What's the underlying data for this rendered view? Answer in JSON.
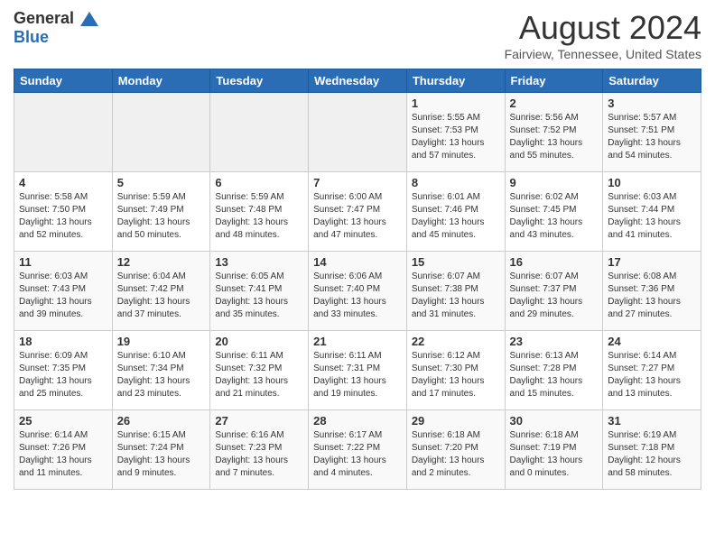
{
  "header": {
    "logo_line1": "General",
    "logo_line2": "Blue",
    "month": "August 2024",
    "location": "Fairview, Tennessee, United States"
  },
  "weekdays": [
    "Sunday",
    "Monday",
    "Tuesday",
    "Wednesday",
    "Thursday",
    "Friday",
    "Saturday"
  ],
  "weeks": [
    [
      {
        "day": "",
        "info": ""
      },
      {
        "day": "",
        "info": ""
      },
      {
        "day": "",
        "info": ""
      },
      {
        "day": "",
        "info": ""
      },
      {
        "day": "1",
        "info": "Sunrise: 5:55 AM\nSunset: 7:53 PM\nDaylight: 13 hours\nand 57 minutes."
      },
      {
        "day": "2",
        "info": "Sunrise: 5:56 AM\nSunset: 7:52 PM\nDaylight: 13 hours\nand 55 minutes."
      },
      {
        "day": "3",
        "info": "Sunrise: 5:57 AM\nSunset: 7:51 PM\nDaylight: 13 hours\nand 54 minutes."
      }
    ],
    [
      {
        "day": "4",
        "info": "Sunrise: 5:58 AM\nSunset: 7:50 PM\nDaylight: 13 hours\nand 52 minutes."
      },
      {
        "day": "5",
        "info": "Sunrise: 5:59 AM\nSunset: 7:49 PM\nDaylight: 13 hours\nand 50 minutes."
      },
      {
        "day": "6",
        "info": "Sunrise: 5:59 AM\nSunset: 7:48 PM\nDaylight: 13 hours\nand 48 minutes."
      },
      {
        "day": "7",
        "info": "Sunrise: 6:00 AM\nSunset: 7:47 PM\nDaylight: 13 hours\nand 47 minutes."
      },
      {
        "day": "8",
        "info": "Sunrise: 6:01 AM\nSunset: 7:46 PM\nDaylight: 13 hours\nand 45 minutes."
      },
      {
        "day": "9",
        "info": "Sunrise: 6:02 AM\nSunset: 7:45 PM\nDaylight: 13 hours\nand 43 minutes."
      },
      {
        "day": "10",
        "info": "Sunrise: 6:03 AM\nSunset: 7:44 PM\nDaylight: 13 hours\nand 41 minutes."
      }
    ],
    [
      {
        "day": "11",
        "info": "Sunrise: 6:03 AM\nSunset: 7:43 PM\nDaylight: 13 hours\nand 39 minutes."
      },
      {
        "day": "12",
        "info": "Sunrise: 6:04 AM\nSunset: 7:42 PM\nDaylight: 13 hours\nand 37 minutes."
      },
      {
        "day": "13",
        "info": "Sunrise: 6:05 AM\nSunset: 7:41 PM\nDaylight: 13 hours\nand 35 minutes."
      },
      {
        "day": "14",
        "info": "Sunrise: 6:06 AM\nSunset: 7:40 PM\nDaylight: 13 hours\nand 33 minutes."
      },
      {
        "day": "15",
        "info": "Sunrise: 6:07 AM\nSunset: 7:38 PM\nDaylight: 13 hours\nand 31 minutes."
      },
      {
        "day": "16",
        "info": "Sunrise: 6:07 AM\nSunset: 7:37 PM\nDaylight: 13 hours\nand 29 minutes."
      },
      {
        "day": "17",
        "info": "Sunrise: 6:08 AM\nSunset: 7:36 PM\nDaylight: 13 hours\nand 27 minutes."
      }
    ],
    [
      {
        "day": "18",
        "info": "Sunrise: 6:09 AM\nSunset: 7:35 PM\nDaylight: 13 hours\nand 25 minutes."
      },
      {
        "day": "19",
        "info": "Sunrise: 6:10 AM\nSunset: 7:34 PM\nDaylight: 13 hours\nand 23 minutes."
      },
      {
        "day": "20",
        "info": "Sunrise: 6:11 AM\nSunset: 7:32 PM\nDaylight: 13 hours\nand 21 minutes."
      },
      {
        "day": "21",
        "info": "Sunrise: 6:11 AM\nSunset: 7:31 PM\nDaylight: 13 hours\nand 19 minutes."
      },
      {
        "day": "22",
        "info": "Sunrise: 6:12 AM\nSunset: 7:30 PM\nDaylight: 13 hours\nand 17 minutes."
      },
      {
        "day": "23",
        "info": "Sunrise: 6:13 AM\nSunset: 7:28 PM\nDaylight: 13 hours\nand 15 minutes."
      },
      {
        "day": "24",
        "info": "Sunrise: 6:14 AM\nSunset: 7:27 PM\nDaylight: 13 hours\nand 13 minutes."
      }
    ],
    [
      {
        "day": "25",
        "info": "Sunrise: 6:14 AM\nSunset: 7:26 PM\nDaylight: 13 hours\nand 11 minutes."
      },
      {
        "day": "26",
        "info": "Sunrise: 6:15 AM\nSunset: 7:24 PM\nDaylight: 13 hours\nand 9 minutes."
      },
      {
        "day": "27",
        "info": "Sunrise: 6:16 AM\nSunset: 7:23 PM\nDaylight: 13 hours\nand 7 minutes."
      },
      {
        "day": "28",
        "info": "Sunrise: 6:17 AM\nSunset: 7:22 PM\nDaylight: 13 hours\nand 4 minutes."
      },
      {
        "day": "29",
        "info": "Sunrise: 6:18 AM\nSunset: 7:20 PM\nDaylight: 13 hours\nand 2 minutes."
      },
      {
        "day": "30",
        "info": "Sunrise: 6:18 AM\nSunset: 7:19 PM\nDaylight: 13 hours\nand 0 minutes."
      },
      {
        "day": "31",
        "info": "Sunrise: 6:19 AM\nSunset: 7:18 PM\nDaylight: 12 hours\nand 58 minutes."
      }
    ]
  ]
}
